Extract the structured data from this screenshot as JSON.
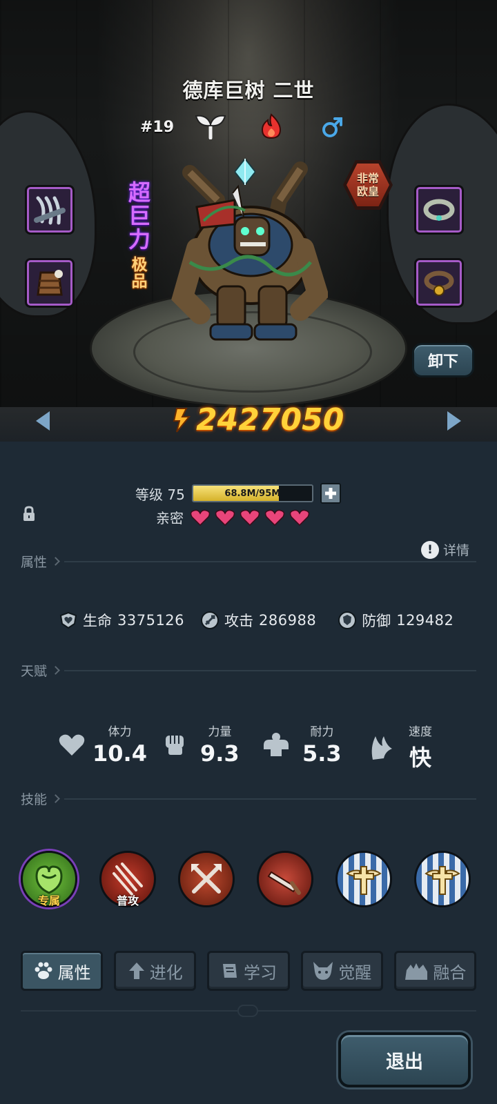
{
  "hero": {
    "name": "德库巨树 二世",
    "number": "#19",
    "rarity_tag_1": "超巨力",
    "rarity_tag_2": "极品",
    "lucky_badge_line1": "非常",
    "lucky_badge_line2": "欧皇",
    "power": "2427050",
    "element_icons": [
      "sprout-icon",
      "fire-icon",
      "male-icon"
    ]
  },
  "equipment": {
    "left": [
      "claw-icon",
      "wooden-armor-icon"
    ],
    "right": [
      "collar-icon",
      "bell-collar-icon"
    ]
  },
  "unequip_label": "卸下",
  "level": {
    "label": "等级 75",
    "exp_text": "68.8M/95M",
    "exp_fraction": 0.724
  },
  "intimacy": {
    "label": "亲密",
    "hearts": 5
  },
  "sections": {
    "attributes": "属性",
    "talent": "天赋",
    "skills": "技能",
    "detail": "详情"
  },
  "attributes": [
    {
      "icon": "heart-shield-icon",
      "name": "生命",
      "value": "3375126"
    },
    {
      "icon": "sword-icon",
      "name": "攻击",
      "value": "286988"
    },
    {
      "icon": "shield-icon",
      "name": "防御",
      "value": "129482"
    }
  ],
  "talents": [
    {
      "icon": "heart-icon",
      "name": "体力",
      "value": "10.4"
    },
    {
      "icon": "fist-icon",
      "name": "力量",
      "value": "9.3"
    },
    {
      "icon": "muscle-icon",
      "name": "耐力",
      "value": "5.3"
    },
    {
      "icon": "wing-icon",
      "name": "速度",
      "value": "快"
    }
  ],
  "skills": [
    {
      "icon": "green-plant-skill-icon",
      "tag": "专属"
    },
    {
      "icon": "claw-slash-skill-icon",
      "tag": "普攻"
    },
    {
      "icon": "crossed-axes-skill-icon",
      "tag": ""
    },
    {
      "icon": "sword-skill-icon",
      "tag": ""
    },
    {
      "icon": "winged-cross-skill-icon",
      "tag": ""
    },
    {
      "icon": "winged-cross-skill-icon",
      "tag": ""
    }
  ],
  "tabs": [
    {
      "icon": "paw-icon",
      "label": "属性",
      "active": true
    },
    {
      "icon": "evolve-arrow-icon",
      "label": "进化",
      "active": false
    },
    {
      "icon": "book-icon",
      "label": "学习",
      "active": false
    },
    {
      "icon": "beast-head-icon",
      "label": "觉醒",
      "active": false
    },
    {
      "icon": "fusion-icon",
      "label": "融合",
      "active": false
    }
  ],
  "exit_label": "退出",
  "colors": {
    "panel_bg": "#1e2a35",
    "power_gold": "#ffd23a",
    "exp_fill": "#d5b22a",
    "heart_pink": "#e8457a",
    "equip_frame": "#a65bc8"
  }
}
